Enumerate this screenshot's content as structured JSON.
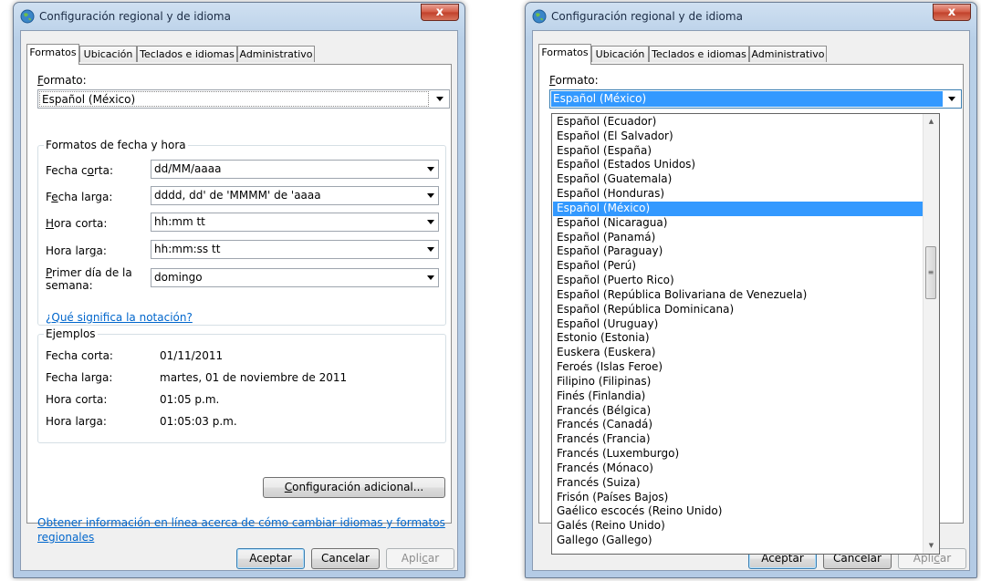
{
  "title": "Configuración regional y de idioma",
  "close_glyph": "x",
  "tabs": [
    "Formatos",
    "Ubicación",
    "Teclados e idiomas",
    "Administrativo"
  ],
  "format": {
    "label": "Formato:",
    "label_access": "F",
    "label_rest": "ormato:",
    "value": "Español (México)"
  },
  "datetime_group": {
    "title": "Formatos de fecha y hora",
    "rows": [
      {
        "label_pre": "Fecha c",
        "label_access": "o",
        "label_post": "rta:",
        "value": "dd/MM/aaaa"
      },
      {
        "label_pre": "F",
        "label_access": "e",
        "label_post": "cha larga:",
        "value": "dddd, dd' de 'MMMM' de 'aaaa"
      },
      {
        "label_pre": "",
        "label_access": "H",
        "label_post": "ora corta:",
        "value": "hh:mm tt"
      },
      {
        "label_pre": "Hora lar",
        "label_access": "g",
        "label_post": "a:",
        "value": "hh:mm:ss tt"
      }
    ],
    "first_day": {
      "label_access": "P",
      "label_line1_rest": "rimer día de la",
      "label_line2": "semana:",
      "value": "domingo"
    }
  },
  "notation_link": "¿Qué significa la notación?",
  "examples": {
    "title": "Ejemplos",
    "rows": [
      {
        "label": "Fecha corta:",
        "value": "01/11/2011"
      },
      {
        "label": "Fecha larga:",
        "value": "martes, 01 de noviembre de 2011"
      },
      {
        "label": "Hora corta:",
        "value": "01:05 p.m."
      },
      {
        "label": "Hora larga:",
        "value": "01:05:03 p.m."
      }
    ]
  },
  "additional_button": {
    "access": "C",
    "rest": "onfiguración adicional..."
  },
  "info_link_line1": "Obtener información en línea acerca de cómo cambiar idiomas y formatos",
  "info_link_line2": "regionales",
  "buttons": {
    "ok": "Aceptar",
    "cancel": "Cancelar",
    "apply_pre": "Apli",
    "apply_access": "c",
    "apply_post": "ar"
  },
  "dropdown": {
    "selected_index": 6,
    "items": [
      "Español (Ecuador)",
      "Español (El Salvador)",
      "Español (España)",
      "Español (Estados Unidos)",
      "Español (Guatemala)",
      "Español (Honduras)",
      "Español (México)",
      "Español (Nicaragua)",
      "Español (Panamá)",
      "Español (Paraguay)",
      "Español (Perú)",
      "Español (Puerto Rico)",
      "Español (República Bolivariana de Venezuela)",
      "Español (República Dominicana)",
      "Español (Uruguay)",
      "Estonio (Estonia)",
      "Euskera (Euskera)",
      "Feroés (Islas Feroe)",
      "Filipino (Filipinas)",
      "Finés (Finlandia)",
      "Francés (Bélgica)",
      "Francés (Canadá)",
      "Francés (Francia)",
      "Francés (Luxemburgo)",
      "Francés (Mónaco)",
      "Francés (Suiza)",
      "Frisón (Países Bajos)",
      "Gaélico escocés (Reino Unido)",
      "Galés (Reino Unido)",
      "Gallego (Gallego)"
    ]
  },
  "scroll_glyphs": {
    "up": "▲",
    "down": "▼",
    "grip": "≡"
  },
  "colors": {
    "selection": "#3399ff",
    "link": "#0066cc",
    "titlebar": "#b9d0e8"
  }
}
